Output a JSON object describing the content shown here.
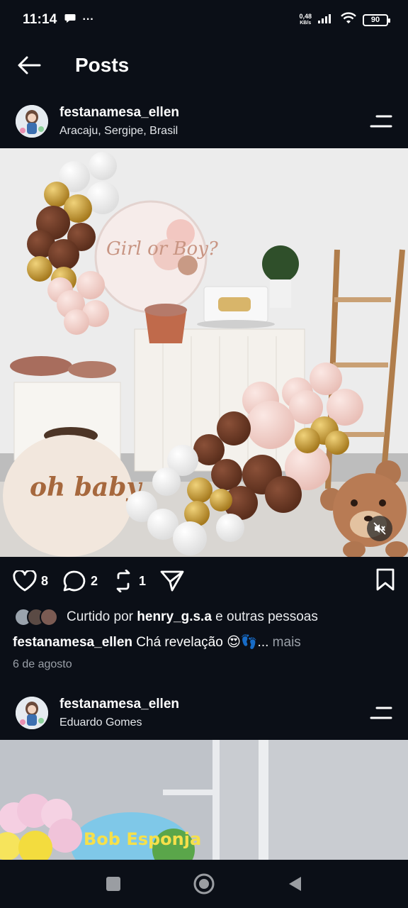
{
  "status": {
    "time": "11:14",
    "net_speed_value": "0,48",
    "net_speed_unit": "KB/s",
    "battery": "90"
  },
  "header": {
    "title": "Posts"
  },
  "posts": [
    {
      "username": "festanamesa_ellen",
      "location": "Aracaju, Sergipe, Brasil",
      "photo_text_1": "Girl or Boy?",
      "photo_text_2": "oh baby",
      "likes": "8",
      "comments": "2",
      "reposts": "1",
      "liked_prefix": "Curtido por",
      "liked_user": "henry_g.s.a",
      "liked_suffix": "e outras pessoas",
      "caption_user": "festanamesa_ellen",
      "caption_text": "Chá revelação 😍👣...",
      "caption_more": "mais",
      "date": "6 de agosto"
    },
    {
      "username": "festanamesa_ellen",
      "location": "Eduardo Gomes",
      "photo_text_1": "Bob Esponja"
    }
  ],
  "colors": {
    "background": "#0b0f17",
    "brown_balloon": "#6b3a24",
    "gold_balloon": "#c9a13a",
    "pink_balloon": "#f1d2cc",
    "muted_text": "#9aa0a8"
  }
}
